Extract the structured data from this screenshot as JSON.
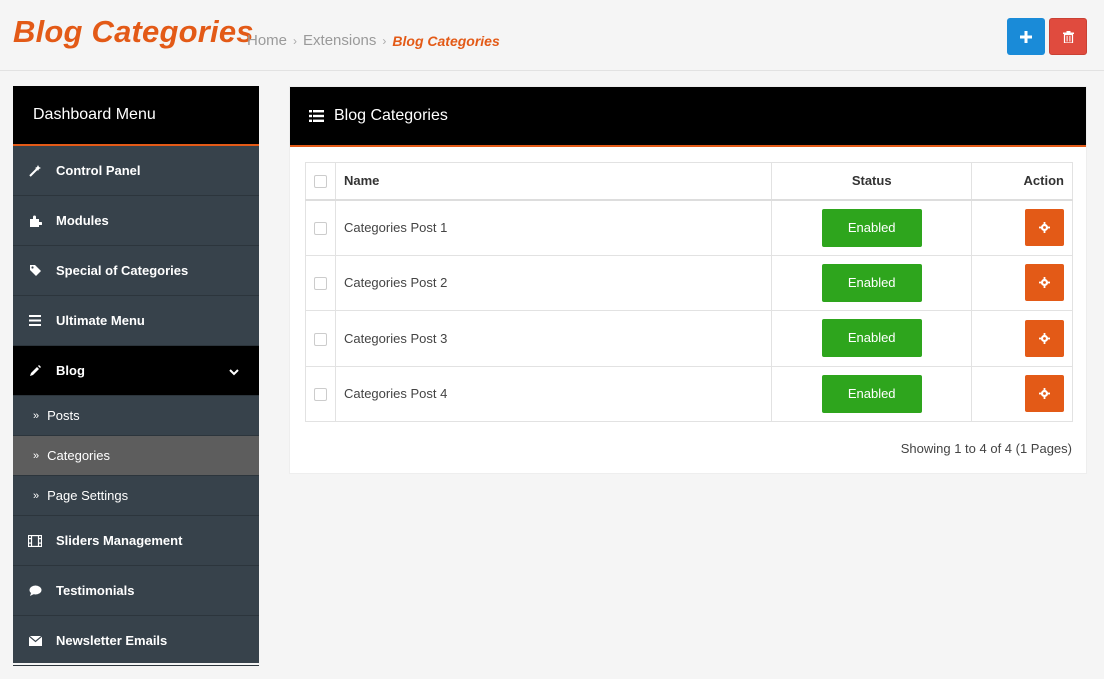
{
  "header": {
    "title": "Blog Categories",
    "breadcrumb": [
      "Home",
      "Extensions",
      "Blog Categories"
    ],
    "add_icon": "plus-icon",
    "delete_icon": "trash-icon"
  },
  "sidebar": {
    "title": "Dashboard Menu",
    "items": [
      {
        "label": "Control Panel",
        "icon": "magic-wand-icon"
      },
      {
        "label": "Modules",
        "icon": "puzzle-icon"
      },
      {
        "label": "Special of Categories",
        "icon": "tag-icon"
      },
      {
        "label": "Ultimate Menu",
        "icon": "bars-icon"
      },
      {
        "label": "Blog",
        "icon": "pencil-icon",
        "expanded": true
      },
      {
        "label": "Sliders Management",
        "icon": "film-icon"
      },
      {
        "label": "Testimonials",
        "icon": "comment-icon"
      },
      {
        "label": "Newsletter Emails",
        "icon": "envelope-icon"
      }
    ],
    "blog_subitems": [
      {
        "label": "Posts"
      },
      {
        "label": "Categories",
        "current": true
      },
      {
        "label": "Page Settings"
      }
    ]
  },
  "panel": {
    "title": "Blog Categories",
    "columns": {
      "name": "Name",
      "status": "Status",
      "action": "Action"
    },
    "rows": [
      {
        "name": "Categories Post 1",
        "status": "Enabled"
      },
      {
        "name": "Categories Post 2",
        "status": "Enabled"
      },
      {
        "name": "Categories Post 3",
        "status": "Enabled"
      },
      {
        "name": "Categories Post 4",
        "status": "Enabled"
      }
    ],
    "pagination_info": "Showing 1 to 4 of 4 (1 Pages)"
  },
  "colors": {
    "accent": "#e35a17",
    "sidebar_bg": "#37424b",
    "status_green": "#2ea51d",
    "add_blue": "#1a8bd8",
    "delete_red": "#e04b3e"
  }
}
